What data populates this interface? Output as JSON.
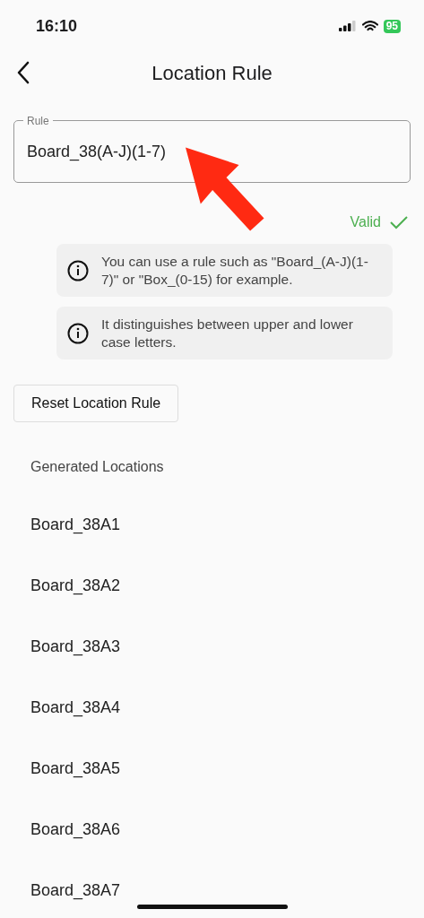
{
  "status_bar": {
    "time": "16:10",
    "battery": "95"
  },
  "header": {
    "title": "Location Rule"
  },
  "rule_field": {
    "label": "Rule",
    "value": "Board_38(A-J)(1-7)"
  },
  "validation": {
    "text": "Valid",
    "valid": true
  },
  "hints": [
    "You can use a rule such as \"Board_(A-J)(1-7)\" or \"Box_(0-15) for example.",
    "It distinguishes between upper and lower case letters."
  ],
  "reset_button": "Reset Location Rule",
  "generated": {
    "heading": "Generated Locations",
    "items": [
      "Board_38A1",
      "Board_38A2",
      "Board_38A3",
      "Board_38A4",
      "Board_38A5",
      "Board_38A6",
      "Board_38A7"
    ]
  }
}
